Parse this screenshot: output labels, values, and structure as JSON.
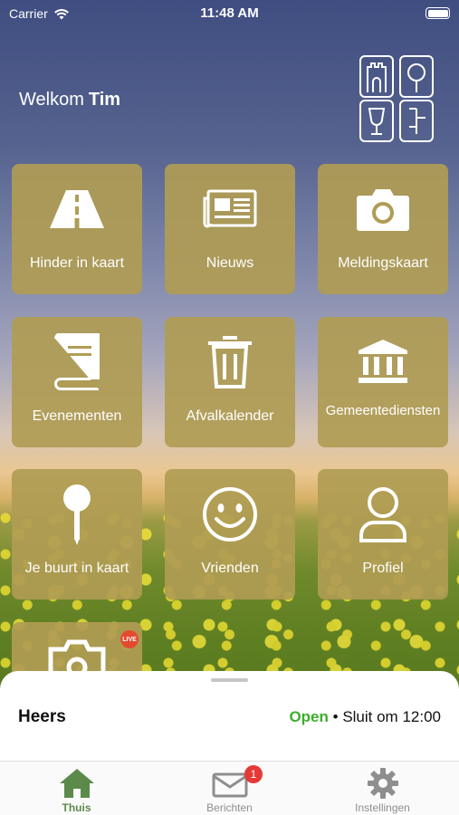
{
  "status_bar": {
    "carrier": "Carrier",
    "time": "11:48 AM"
  },
  "header": {
    "greeting": "Welkom",
    "user_name": "Tim"
  },
  "tiles": [
    {
      "label": "Hinder in kaart",
      "icon": "road-icon"
    },
    {
      "label": "Nieuws",
      "icon": "newspaper-icon"
    },
    {
      "label": "Meldingskaart",
      "icon": "camera-icon"
    },
    {
      "label": "Evenementen",
      "icon": "book-icon"
    },
    {
      "label": "Afvalkalender",
      "icon": "trash-icon"
    },
    {
      "label": "Gemeentediensten",
      "icon": "building-icon"
    },
    {
      "label": "Je buurt in kaart",
      "icon": "pin-icon"
    },
    {
      "label": "Vrienden",
      "icon": "smiley-icon"
    },
    {
      "label": "Profiel",
      "icon": "person-icon"
    },
    {
      "label": "",
      "icon": "camera-icon",
      "badge": "LIVE"
    }
  ],
  "location_sheet": {
    "place": "Heers",
    "status": "Open",
    "separator": "•",
    "closing": "Sluit om 12:00"
  },
  "tab_bar": [
    {
      "label": "Thuis",
      "icon": "home-icon",
      "active": true
    },
    {
      "label": "Berichten",
      "icon": "mail-icon",
      "badge": "1"
    },
    {
      "label": "Instellingen",
      "icon": "gear-icon"
    }
  ],
  "colors": {
    "tile": "#b09c54",
    "accent_green": "#3cae2a",
    "active_tab": "#5b8a4a",
    "badge_red": "#e53935"
  }
}
